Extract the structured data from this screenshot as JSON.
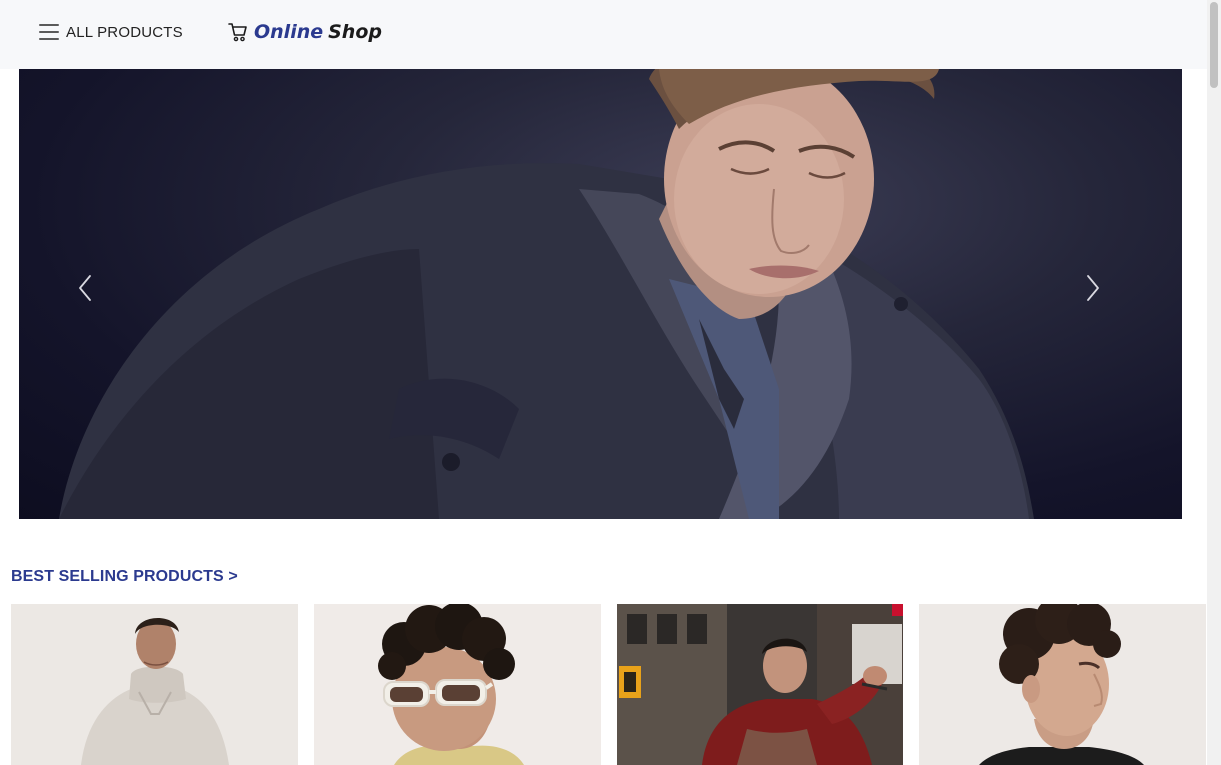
{
  "header": {
    "menu_label": "ALL PRODUCTS",
    "brand_part1": "Online",
    "brand_part2": "Shop",
    "icons": {
      "menu": "hamburger-icon",
      "brand": "cart-icon"
    }
  },
  "carousel": {
    "prev_icon": "chevron-left-icon",
    "next_icon": "chevron-right-icon"
  },
  "best_selling": {
    "title": "BEST SELLING PRODUCTS >"
  },
  "colors": {
    "brand_blue": "#2b3a8f",
    "header_bg": "#f7f8fa"
  }
}
